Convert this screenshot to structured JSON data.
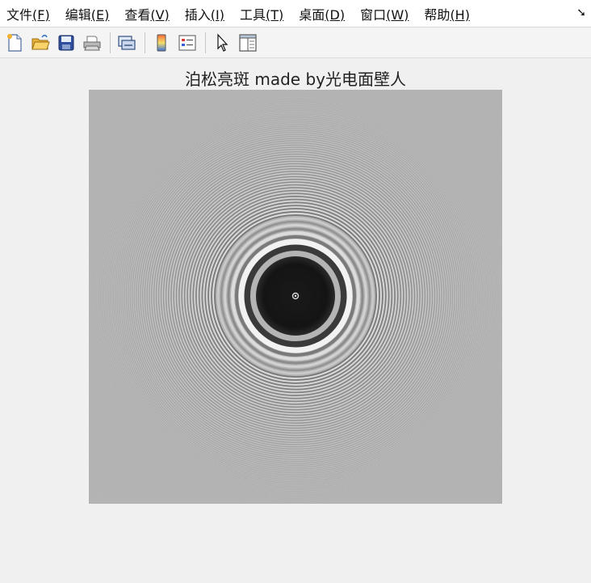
{
  "menu": {
    "items": [
      {
        "label": "文件",
        "accel": "(F)"
      },
      {
        "label": "编辑",
        "accel": "(E)"
      },
      {
        "label": "查看",
        "accel": "(V)"
      },
      {
        "label": "插入",
        "accel": "(I)"
      },
      {
        "label": "工具",
        "accel": "(T)"
      },
      {
        "label": "桌面",
        "accel": "(D)"
      },
      {
        "label": "窗口",
        "accel": "(W)"
      },
      {
        "label": "帮助",
        "accel": "(H)"
      }
    ],
    "dock_icon": "dock-arrow-icon"
  },
  "toolbar": {
    "buttons": [
      "new-figure-icon",
      "open-file-icon",
      "save-icon",
      "print-icon",
      "link-plot-icon",
      "colorbar-icon",
      "legend-icon",
      "pointer-icon",
      "property-editor-icon"
    ]
  },
  "figure": {
    "title": "泊松亮斑 made by光电面壁人"
  },
  "colors": {
    "background": "#f0f0f0",
    "plot_background": "#b4b4b4",
    "dark_spot": "#141414",
    "bright_ring": "#f2f2f2"
  }
}
